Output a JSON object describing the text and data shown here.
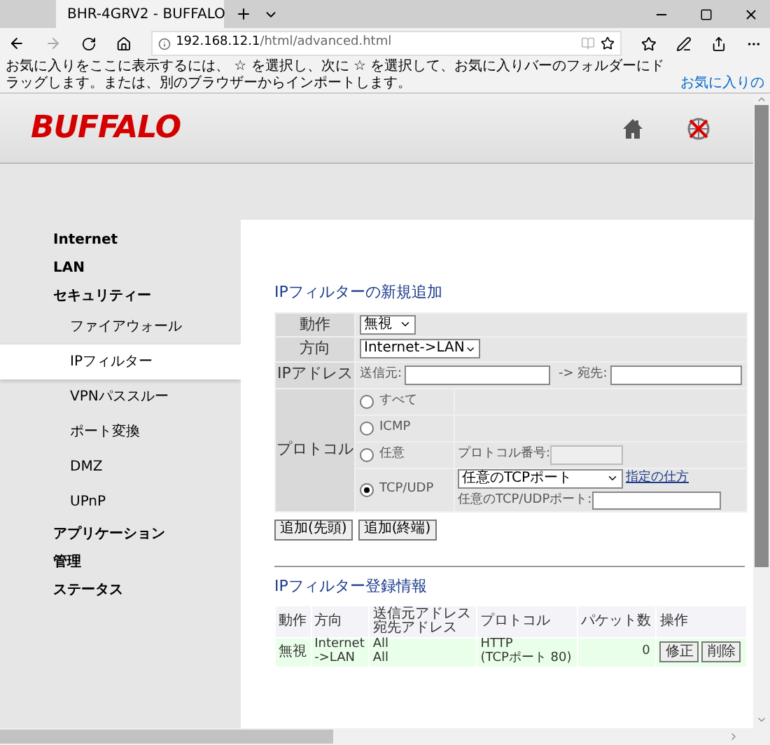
{
  "browser": {
    "tab_title": "BHR-4GRV2 - BUFFALO",
    "url_host": "192.168.12.1",
    "url_path": "/html/advanced.html",
    "favorites_text": "お気に入りをここに表示するには、 ☆ を選択し、次に ☆ を選択して、お気に入りバーのフォルダーにドラッグします。または、別のブラウザーからインポートします。",
    "favorites_link": "お気に入りの"
  },
  "header": {
    "logo": "BUFFALO"
  },
  "sidebar": {
    "items": [
      {
        "label": "Internet",
        "selected": false
      },
      {
        "label": "LAN",
        "selected": false
      },
      {
        "label": "セキュリティー",
        "selected": false,
        "children": [
          {
            "label": "ファイアウォール",
            "selected": false
          },
          {
            "label": "IPフィルター",
            "selected": true
          },
          {
            "label": "VPNパススルー",
            "selected": false
          },
          {
            "label": "ポート変換",
            "selected": false
          },
          {
            "label": "DMZ",
            "selected": false
          },
          {
            "label": "UPnP",
            "selected": false
          }
        ]
      },
      {
        "label": "アプリケーション",
        "selected": false
      },
      {
        "label": "管理",
        "selected": false
      },
      {
        "label": "ステータス",
        "selected": false
      }
    ]
  },
  "new_filter": {
    "title": "IPフィルターの新規追加",
    "action": {
      "label": "動作",
      "value": "無視"
    },
    "direction": {
      "label": "方向",
      "value": "Internet->LAN"
    },
    "ip_address": {
      "label": "IPアドレス",
      "source_label": "送信元:",
      "dest_label": "-> 宛先:"
    },
    "protocol": {
      "label": "プロトコル",
      "options": [
        {
          "label": "すべて",
          "selected": false,
          "kind": "plain"
        },
        {
          "label": "ICMP",
          "selected": false,
          "kind": "plain"
        },
        {
          "label": "任意",
          "selected": false,
          "kind": "number"
        },
        {
          "label": "TCP/UDP",
          "selected": true,
          "kind": "port"
        }
      ],
      "number_label": "プロトコル番号:",
      "port_select": "任意のTCPポート",
      "howto_link": "指定の仕方",
      "port_label": "任意のTCP/UDPポート:"
    },
    "buttons": [
      "追加(先頭)",
      "追加(終端)"
    ]
  },
  "registered": {
    "title": "IPフィルター登録情報",
    "columns": [
      [
        "動作"
      ],
      [
        "方向"
      ],
      [
        "送信元アドレス",
        "宛先アドレス"
      ],
      [
        "プロトコル"
      ],
      [
        "パケット数"
      ],
      [
        "操作"
      ]
    ],
    "rows": [
      {
        "action": "無視",
        "direction": [
          "Internet",
          "->LAN"
        ],
        "addresses": [
          "All",
          "All"
        ],
        "protocol": [
          "HTTP",
          "(TCPポート 80)"
        ],
        "packets": "0",
        "buttons": [
          "修正",
          "削除"
        ]
      }
    ]
  }
}
